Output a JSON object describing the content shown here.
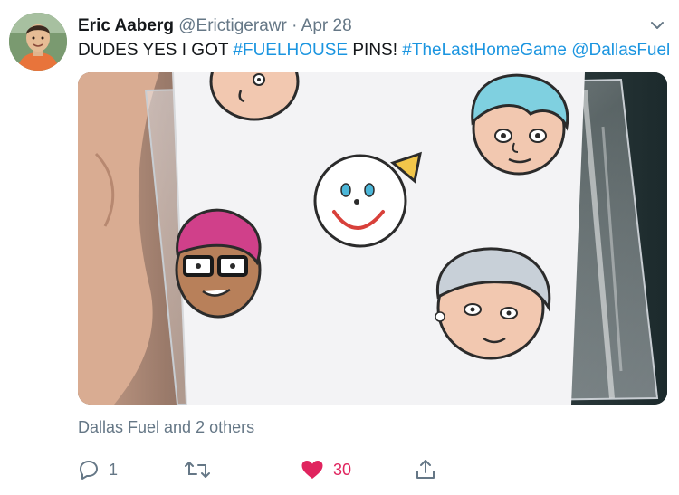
{
  "tweet": {
    "author_name": "Eric Aaberg",
    "author_handle": "@Erictigerawr",
    "separator": "·",
    "date": "Apr 28",
    "text_plain": "DUDES YES I GOT ",
    "hashtag_1": "#FUELHOUSE",
    "text_mid": " PINS! ",
    "hashtag_2": "#TheLastHomeGame",
    "mention": "@DallasFuel",
    "social_context": "Dallas Fuel and 2 others",
    "reply_count": "1",
    "like_count": "30"
  },
  "icons": {
    "caret": "chevron-down-icon",
    "reply": "reply-icon",
    "retweet": "retweet-icon",
    "like": "heart-icon",
    "share": "share-icon"
  },
  "colors": {
    "link": "#1b95e0",
    "secondary_text": "#657786",
    "like": "#e0245e"
  }
}
